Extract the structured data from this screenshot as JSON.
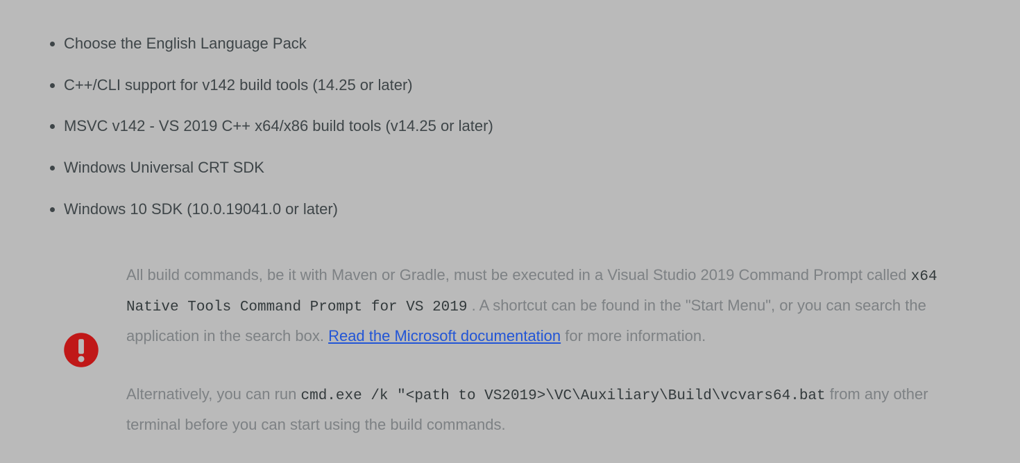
{
  "requirements": [
    "Choose the English Language Pack",
    "C++/CLI support for v142 build tools (14.25 or later)",
    "MSVC v142 - VS 2019 C++ x64/x86 build tools (v14.25 or later)",
    "Windows Universal CRT SDK",
    "Windows 10 SDK (10.0.19041.0 or later)"
  ],
  "note": {
    "p1_a": "All build commands, be it with Maven or Gradle, must be executed in a Visual Studio 2019 Command Prompt called ",
    "p1_code": "x64 Native Tools Command Prompt for VS 2019",
    "p1_b": ". A shortcut can be found in the \"Start Menu\", or you can search the application in the search box. ",
    "p1_link": "Read the Microsoft documentation",
    "p1_c": " for more information.",
    "p2_a": "Alternatively, you can run ",
    "p2_code": "cmd.exe /k \"<path to VS2019>\\VC\\Auxiliary\\Build\\vcvars64.bat",
    "p2_b": " from any other terminal before you can start using the build commands."
  }
}
